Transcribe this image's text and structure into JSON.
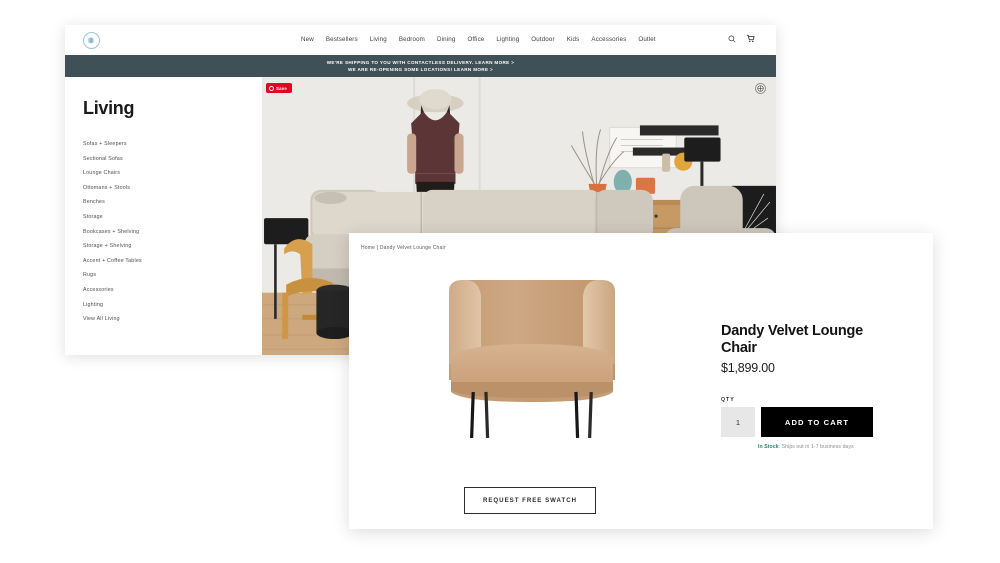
{
  "site": {
    "logo_icon": "circle-monogram-logo",
    "nav_items": [
      {
        "label": "New"
      },
      {
        "label": "Bestsellers"
      },
      {
        "label": "Living"
      },
      {
        "label": "Bedroom"
      },
      {
        "label": "Dining"
      },
      {
        "label": "Office"
      },
      {
        "label": "Lighting"
      },
      {
        "label": "Outdoor"
      },
      {
        "label": "Kids"
      },
      {
        "label": "Accessories"
      },
      {
        "label": "Outlet"
      }
    ],
    "icons": {
      "search": "search-icon",
      "cart": "shopping-cart-icon"
    },
    "banner": {
      "line1": "WE'RE SHIPPING TO YOU WITH CONTACTLESS DELIVERY. LEARN MORE >",
      "line2": "WE ARE RE-OPENING SOME LOCATIONS! LEARN MORE >",
      "background": "#3f5157"
    }
  },
  "category_page": {
    "title": "Living",
    "categories": [
      "Sofas + Sleepers",
      "Sectional Sofas",
      "Lounge Chairs",
      "Ottomans + Stools",
      "Benches",
      "Storage",
      "Bookcases + Shelving",
      "Storage + Shelving",
      "Accent + Coffee Tables",
      "Rugs",
      "Accessories",
      "Lighting",
      "View All Living"
    ],
    "hero": {
      "alt": "living-room-scene-with-sectional-sofa",
      "save_badge": "Save",
      "save_badge_color": "#e60023",
      "expand_icon": "expand-zoom-icon"
    }
  },
  "product_modal": {
    "breadcrumb": "Home | Dandy Velvet Lounge Chair",
    "product_image_alt": "dandy-velvet-lounge-chair-camel",
    "swatch_button": "REQUEST FREE SWATCH",
    "carousel": {
      "count": 5,
      "active_index": 0
    },
    "title": "Dandy Velvet Lounge Chair",
    "price": "$1,899.00",
    "qty_label": "QTY",
    "qty_value": "1",
    "add_to_cart": "ADD TO CART",
    "stock_status": "In Stock",
    "stock_detail": ": Ships out in 1-7 business days",
    "stock_color": "#2d7d6e"
  }
}
